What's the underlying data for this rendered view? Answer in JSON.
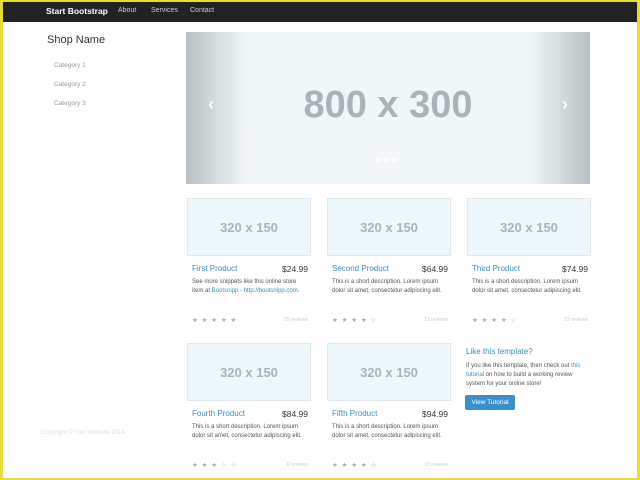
{
  "navbar": {
    "brand": "Start Bootstrap",
    "links": [
      "About",
      "Services",
      "Contact"
    ]
  },
  "sidebar": {
    "title": "Shop Name",
    "categories": [
      "Category 1",
      "Category 2",
      "Category 3"
    ]
  },
  "carousel": {
    "label": "800 x 300",
    "prev_icon": "chevron-left-icon",
    "next_icon": "chevron-right-icon"
  },
  "products": [
    {
      "thumb": "320 x 150",
      "title": "First Product",
      "price": "$24.99",
      "desc_a": "See more snippets like this online store item at ",
      "desc_link": "Bootsnipp - http://bootsnipp.com",
      "desc_b": ".",
      "stars": "★ ★ ★ ★ ★",
      "reviews": "15 reviews"
    },
    {
      "thumb": "320 x 150",
      "title": "Second Product",
      "price": "$64.99",
      "desc_a": "This is a short description. Lorem ipsum dolor sit amet, consectetur adipiscing elit.",
      "desc_link": "",
      "desc_b": "",
      "stars": "★ ★ ★ ★ ☆",
      "reviews": "12 reviews"
    },
    {
      "thumb": "320 x 150",
      "title": "Third Product",
      "price": "$74.99",
      "desc_a": "This is a short description. Lorem ipsum dolor sit amet, consectetur adipiscing elit.",
      "desc_link": "",
      "desc_b": "",
      "stars": "★ ★ ★ ★ ☆",
      "reviews": "31 reviews"
    },
    {
      "thumb": "320 x 150",
      "title": "Fourth Product",
      "price": "$84.99",
      "desc_a": "This is a short description. Lorem ipsum dolor sit amet, consectetur adipiscing elit.",
      "desc_link": "",
      "desc_b": "",
      "stars": "★ ★ ★ ☆ ☆",
      "reviews": "6 reviews"
    },
    {
      "thumb": "320 x 150",
      "title": "Fifth Product",
      "price": "$94.99",
      "desc_a": "This is a short description. Lorem ipsum dolor sit amet, consectetur adipiscing elit.",
      "desc_link": "",
      "desc_b": "",
      "stars": "★ ★ ★ ★ ☆",
      "reviews": "18 reviews"
    }
  ],
  "promo": {
    "title": "Like this template?",
    "text_a": "If you like this template, then check out ",
    "link": "this tutorial",
    "text_b": " on how to build a working review system for your online store!",
    "button": "View Tutorial"
  },
  "footer": {
    "text": "Copyright © Your Website 2014"
  }
}
